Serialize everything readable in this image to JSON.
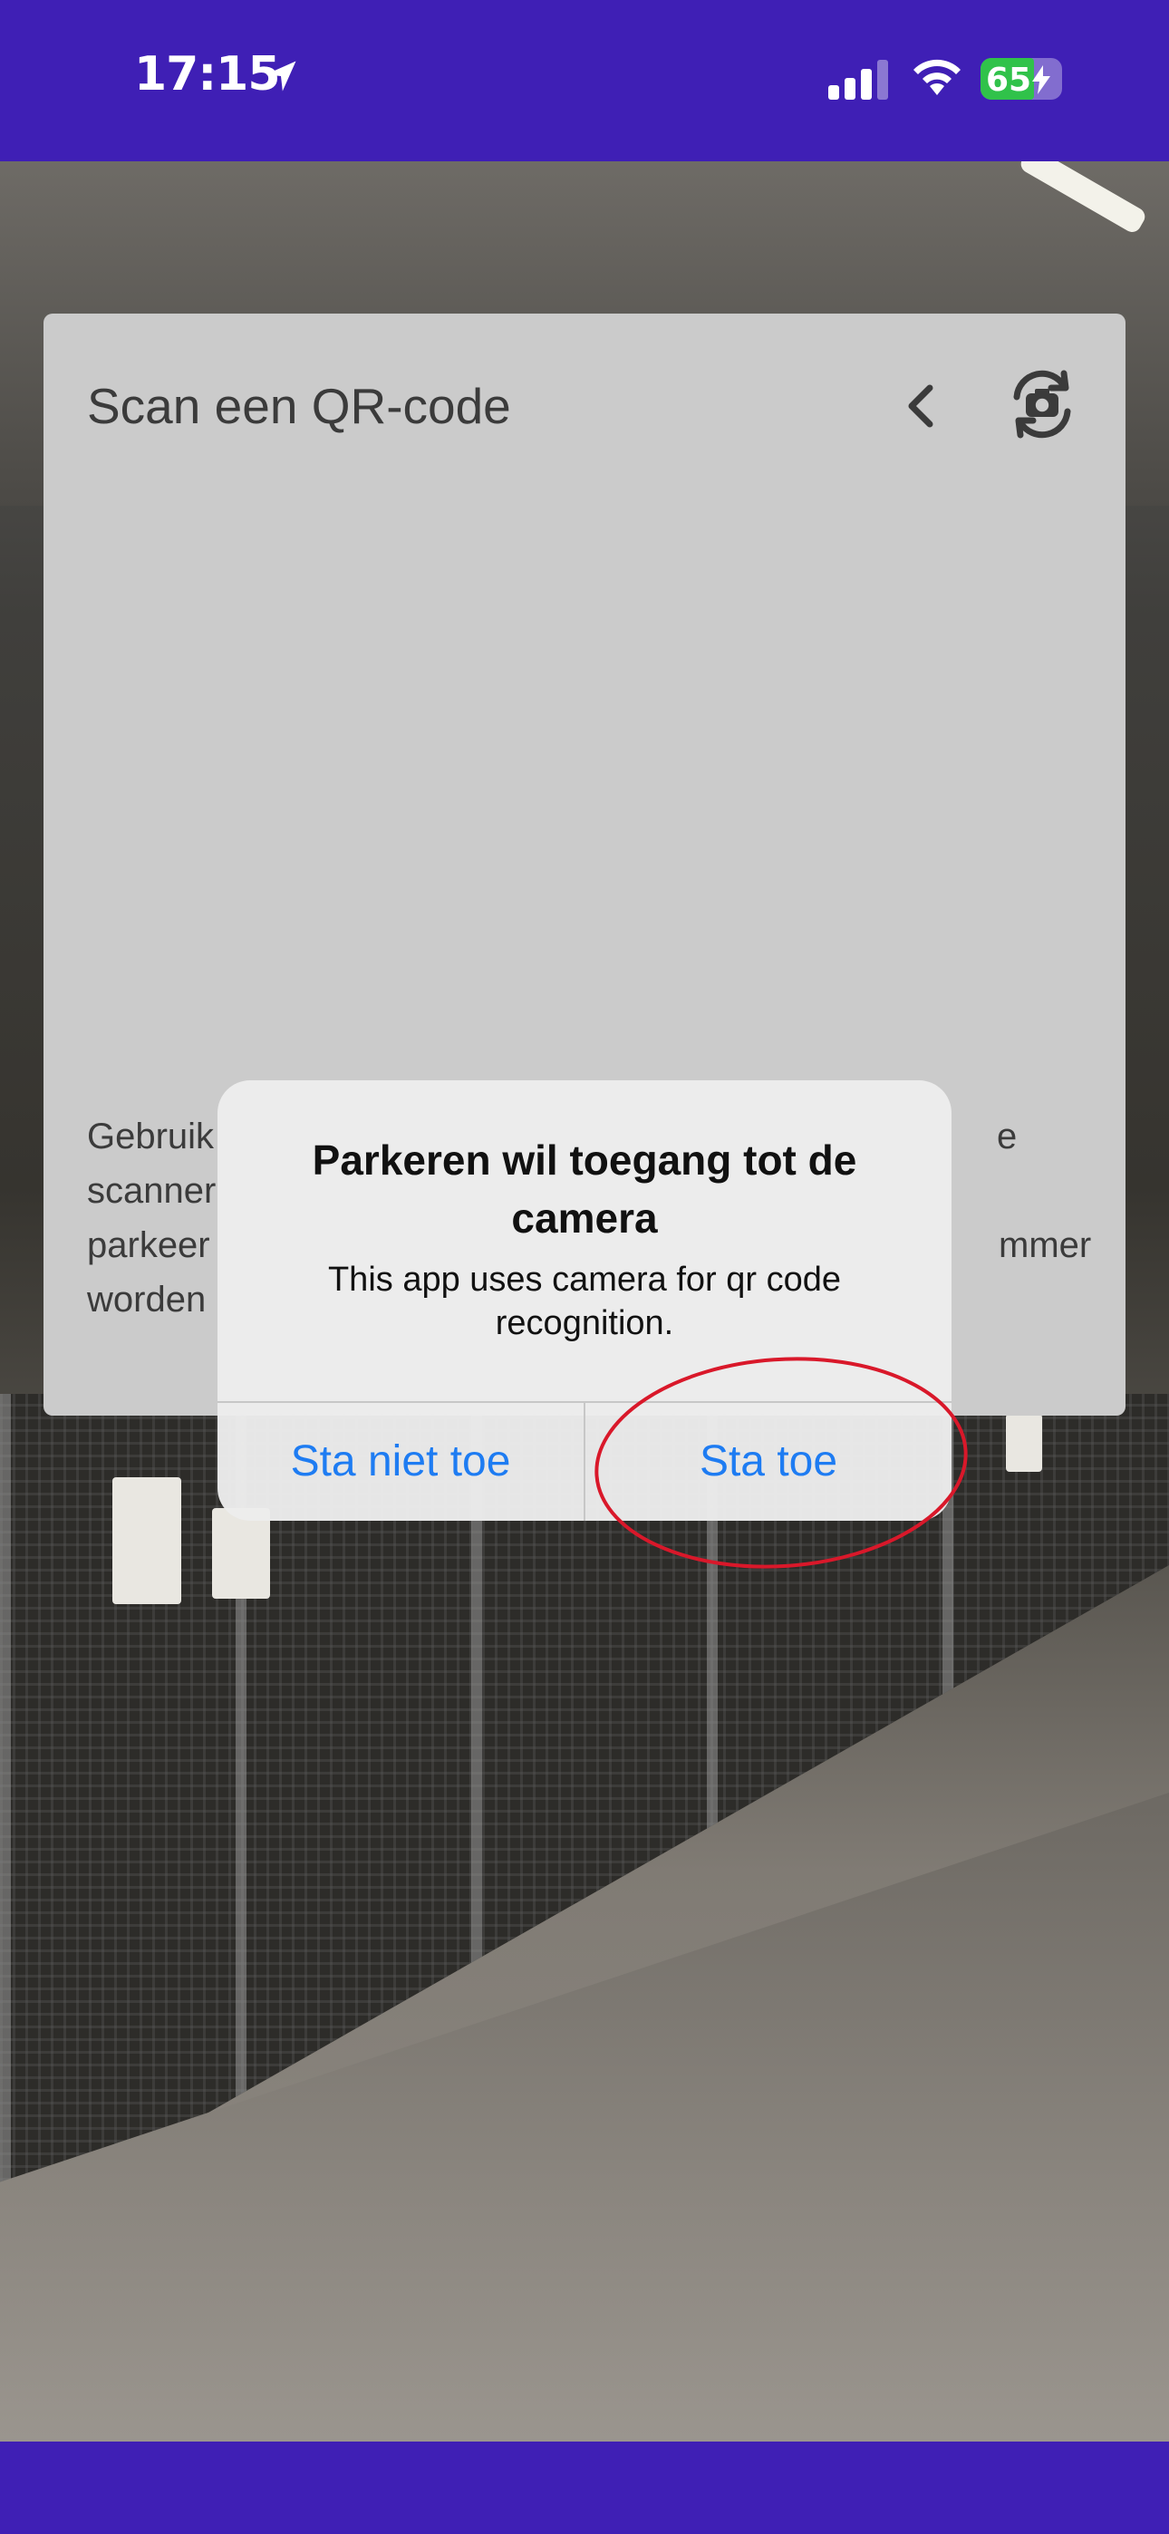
{
  "status_bar": {
    "time": "17:15",
    "battery": "65",
    "battery_level": 0.65,
    "icons": [
      "location-arrow-icon",
      "cellular-signal-icon",
      "wifi-icon",
      "battery-charging-icon"
    ]
  },
  "colors": {
    "brand": "#3f1fb5",
    "card_bg": "#cbcbcb",
    "ios_blue": "#1e7cf2",
    "highlight_red": "#d9182a",
    "battery_green": "#30c24a"
  },
  "scanner": {
    "title": "Scan een QR-code",
    "icons": [
      "chevron-left-icon",
      "camera-flip-icon"
    ],
    "instruction_lines": [
      "Gebruik",
      "scanner",
      "parkeer",
      "worden",
      "e",
      "mmer"
    ]
  },
  "permission_dialog": {
    "title": "Parkeren wil toegang tot de camera",
    "message": "This app uses camera for qr code recognition.",
    "deny_label": "Sta niet toe",
    "allow_label": "Sta toe"
  }
}
